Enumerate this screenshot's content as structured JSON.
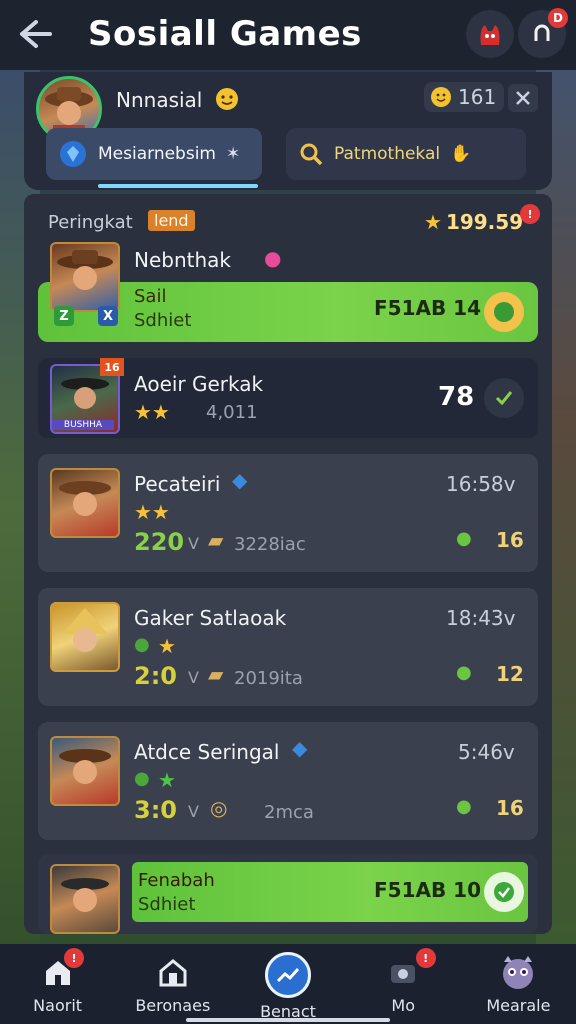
{
  "header": {
    "title": "Sosiall Games",
    "notification_badge": "D"
  },
  "profile": {
    "name": "Nnnasial",
    "coin_count": "161"
  },
  "tabs": [
    {
      "label": "Mesiarnebsim",
      "active": true
    },
    {
      "label": "Patmothekal",
      "active": false
    }
  ],
  "leaderboard": {
    "rank_label": "Peringkat",
    "rank_tag": "lend",
    "top_score": "199.59"
  },
  "rows": [
    {
      "name": "Nebnthak",
      "tag1": "Sail",
      "tag2": "Sdhiet",
      "value": "F51AB 14",
      "highlight": true,
      "badges": [
        "Z",
        "X"
      ]
    },
    {
      "name": "Aoeir Gerkak",
      "stars": "★★",
      "rating": "4,011",
      "score": "78",
      "avatar_badge": "16",
      "avatar_caption": "BUSHHA"
    },
    {
      "name": "Pecateiri",
      "stars": "★★",
      "big": "220",
      "v": "V",
      "meta": "3228iac",
      "time": "16:58v",
      "count": "16"
    },
    {
      "name": "Gaker Satlaoak",
      "stars": "★",
      "big": "2:0",
      "v": "V",
      "meta": "2019ita",
      "time": "18:43v",
      "count": "12"
    },
    {
      "name": "Atdce Seringal",
      "stars": "★",
      "big": "3:0",
      "v": "V",
      "meta": "2mca",
      "time": "5:46v",
      "count": "16"
    },
    {
      "name": "Fenabah",
      "tag2": "Sdhiet",
      "value": "F51AB 10",
      "highlight": true
    }
  ],
  "bottom_nav": [
    {
      "label": "Naorit",
      "icon": "home-icon",
      "badge": "!"
    },
    {
      "label": "Beronaes",
      "icon": "store-icon"
    },
    {
      "label": "Benact",
      "icon": "chart-icon",
      "active": true
    },
    {
      "label": "Mo",
      "icon": "camera-icon",
      "badge": "!"
    },
    {
      "label": "Mearale",
      "icon": "monster-avatar-icon"
    }
  ],
  "colors": {
    "accent_green": "#6ac540",
    "gold": "#ffe08a",
    "panel": "#2a303e",
    "badge_red": "#e23a3a"
  }
}
